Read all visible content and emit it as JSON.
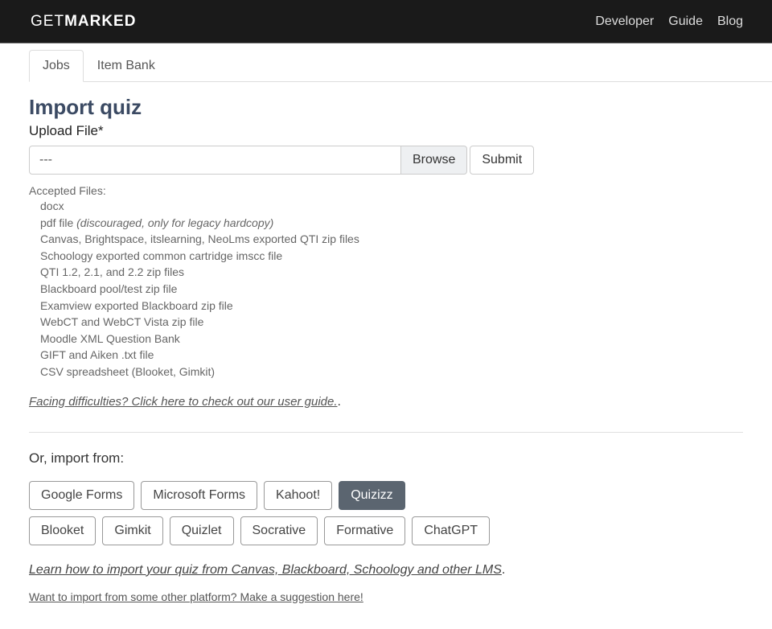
{
  "header": {
    "logo_light": "GET",
    "logo_bold": "MARKED",
    "nav": [
      "Developer",
      "Guide",
      "Blog"
    ]
  },
  "tabs": {
    "jobs": "Jobs",
    "item_bank": "Item Bank"
  },
  "page": {
    "title": "Import quiz",
    "upload_label": "Upload File*",
    "file_value": "---",
    "browse": "Browse",
    "submit": "Submit"
  },
  "accepted": {
    "label": "Accepted Files:",
    "items": [
      "docx",
      "pdf file ",
      "Canvas, Brightspace, itslearning, NeoLms exported QTI zip files",
      "Schoology exported common cartridge imscc file",
      "QTI 1.2, 2.1, and 2.2 zip files",
      "Blackboard pool/test zip file",
      "Examview exported Blackboard zip file",
      "WebCT and WebCT Vista zip file",
      "Moodle XML Question Bank",
      "GIFT and Aiken .txt file",
      "CSV spreadsheet (Blooket, Gimkit)"
    ],
    "pdf_note": "(discouraged, only for legacy hardcopy)"
  },
  "help": {
    "difficulties": "Facing difficulties? Click here to check out our user guide.",
    "trailing_dot": "."
  },
  "import_from": {
    "label": "Or, import from:",
    "row1": [
      "Google Forms",
      "Microsoft Forms",
      "Kahoot!",
      "Quizizz"
    ],
    "row2": [
      "Blooket",
      "Gimkit",
      "Quizlet",
      "Socrative",
      "Formative",
      "ChatGPT"
    ],
    "selected": "Quizizz"
  },
  "links": {
    "lms": "Learn how to import your quiz from Canvas, Blackboard, Schoology and other LMS",
    "lms_dot": ".",
    "suggest": "Want to import from some other platform? Make a suggestion here!"
  }
}
